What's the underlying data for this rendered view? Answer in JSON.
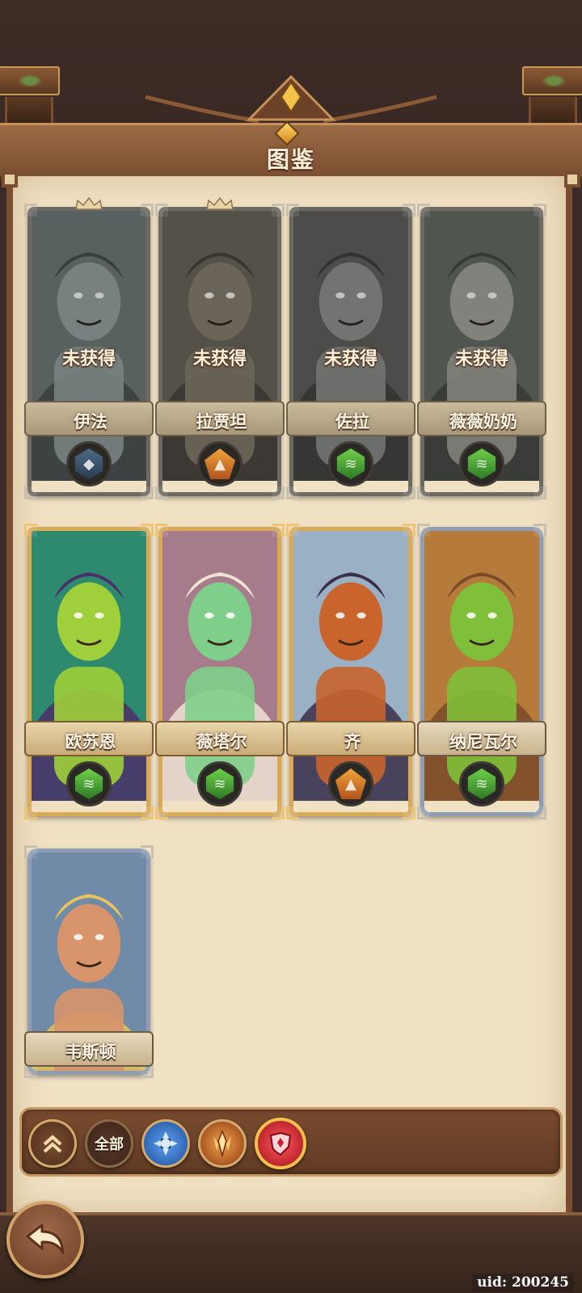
{
  "header": {
    "title": "图鉴"
  },
  "locked_label": "未获得",
  "heroes": [
    {
      "name": "伊法",
      "obtained": false,
      "element": "water",
      "crown": true,
      "colors": {
        "bg": "#5e7b77",
        "skin": "#7fa39a",
        "accent": "#394f4f"
      }
    },
    {
      "name": "拉贾坦",
      "obtained": false,
      "element": "earth",
      "crown": true,
      "colors": {
        "bg": "#6e6246",
        "skin": "#8e7a52",
        "accent": "#4b4030"
      }
    },
    {
      "name": "佐拉",
      "obtained": false,
      "element": "wind",
      "crown": false,
      "colors": {
        "bg": "#5c5f55",
        "skin": "#8a8f86",
        "accent": "#3d3e38"
      }
    },
    {
      "name": "薇薇奶奶",
      "obtained": false,
      "element": "wind",
      "crown": false,
      "colors": {
        "bg": "#5e6a5a",
        "skin": "#9aa08a",
        "accent": "#3c4638"
      }
    },
    {
      "name": "欧苏恩",
      "obtained": true,
      "element": "wind",
      "crown": false,
      "colors": {
        "bg": "#2e8a6f",
        "skin": "#9fcf3a",
        "accent": "#4a2f6a"
      }
    },
    {
      "name": "薇塔尔",
      "obtained": true,
      "element": "wind",
      "crown": false,
      "colors": {
        "bg": "#a67c8c",
        "skin": "#7fcf8a",
        "accent": "#efe3d2"
      }
    },
    {
      "name": "齐",
      "obtained": true,
      "element": "earth",
      "crown": false,
      "colors": {
        "bg": "#9ab0c4",
        "skin": "#c8642c",
        "accent": "#3b2f4a"
      }
    },
    {
      "name": "纳尼瓦尔",
      "obtained": true,
      "element": "wind",
      "crown": false,
      "colors": {
        "bg": "#b67a3a",
        "skin": "#7fbf3a",
        "accent": "#7a4a2a"
      }
    },
    {
      "name": "韦斯顿",
      "obtained": true,
      "element": "none",
      "crown": false,
      "colors": {
        "bg": "#6f8ba8",
        "skin": "#d8946a",
        "accent": "#e8c25a"
      }
    }
  ],
  "filters": {
    "collapse_icon": "double-chevron-up-icon",
    "all_label": "全部",
    "items": [
      {
        "icon": "water-faction-icon",
        "color": "#2c6cc9"
      },
      {
        "icon": "fire-faction-icon",
        "color": "#c8651f"
      },
      {
        "icon": "crimson-faction-icon",
        "color": "#d3253a"
      }
    ]
  },
  "footer": {
    "uid_text": "uid: 200245",
    "back_icon": "back-arrow-icon"
  }
}
